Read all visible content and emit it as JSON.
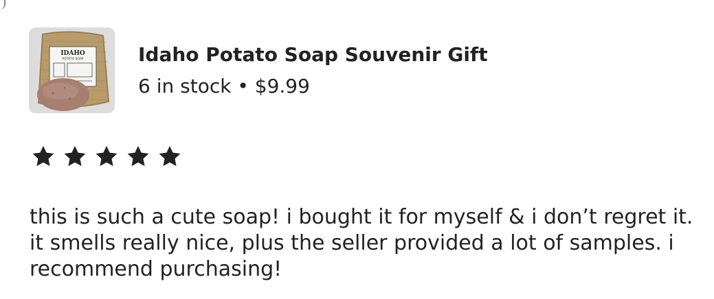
{
  "product": {
    "title": "Idaho Potato Soap Souvenir Gift",
    "stock": "6 in stock",
    "separator": "•",
    "price": "$9.99",
    "thumbnail_label": "IDAHO",
    "thumbnail_sublabel": "POTATO SOAP"
  },
  "review": {
    "rating": 5,
    "max_rating": 5,
    "star_icon": "star-icon",
    "text": "this is such a cute soap! i bought it for myself & i don’t regret it. it smells really nice, plus the seller provided a lot of samples. i recommend purchasing!"
  },
  "colors": {
    "text": "#222222",
    "star": "#222222",
    "background": "#ffffff"
  }
}
